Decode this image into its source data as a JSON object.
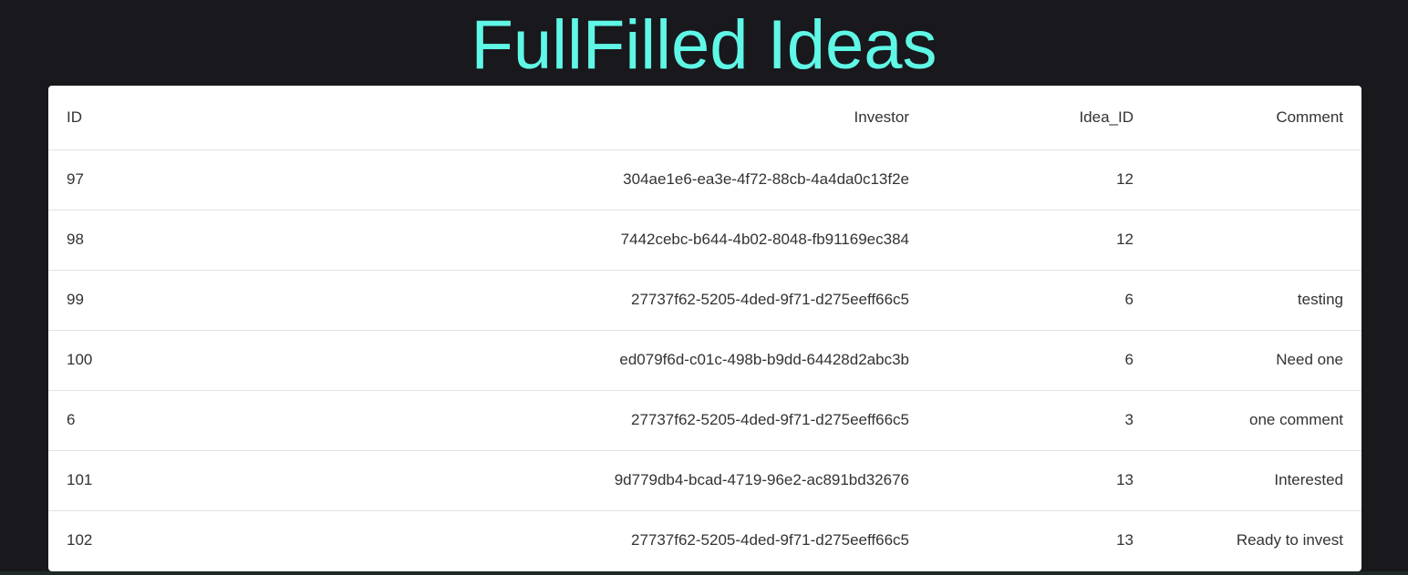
{
  "page": {
    "title": "FullFilled Ideas"
  },
  "table": {
    "columns": {
      "id": "ID",
      "investor": "Investor",
      "idea_id": "Idea_ID",
      "comment": "Comment"
    },
    "rows": [
      {
        "id": "97",
        "investor": "304ae1e6-ea3e-4f72-88cb-4a4da0c13f2e",
        "idea_id": "12",
        "comment": ""
      },
      {
        "id": "98",
        "investor": "7442cebc-b644-4b02-8048-fb91169ec384",
        "idea_id": "12",
        "comment": ""
      },
      {
        "id": "99",
        "investor": "27737f62-5205-4ded-9f71-d275eeff66c5",
        "idea_id": "6",
        "comment": "testing"
      },
      {
        "id": "100",
        "investor": "ed079f6d-c01c-498b-b9dd-64428d2abc3b",
        "idea_id": "6",
        "comment": "Need one"
      },
      {
        "id": "6",
        "investor": "27737f62-5205-4ded-9f71-d275eeff66c5",
        "idea_id": "3",
        "comment": "one comment"
      },
      {
        "id": "101",
        "investor": "9d779db4-bcad-4719-96e2-ac891bd32676",
        "idea_id": "13",
        "comment": "Interested"
      },
      {
        "id": "102",
        "investor": "27737f62-5205-4ded-9f71-d275eeff66c5",
        "idea_id": "13",
        "comment": "Ready to invest"
      }
    ]
  },
  "colors": {
    "background": "#18181d",
    "title": "#5ff7e6",
    "card": "#ffffff",
    "text": "#333333"
  }
}
